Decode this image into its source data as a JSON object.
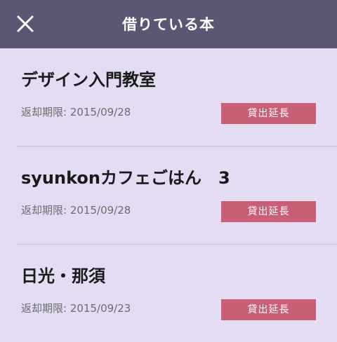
{
  "header": {
    "title": "借りている本",
    "close_icon": "close-icon"
  },
  "colors": {
    "header_bg": "#5d5574",
    "page_bg": "#e3dcf2",
    "button_bg": "#c85f75"
  },
  "books": [
    {
      "title": "デザイン入門教室",
      "due_label": "返却期限:",
      "due_date": "2015/09/28",
      "extend_label": "貸出延長"
    },
    {
      "title": "syunkonカフェごはん　3",
      "due_label": "返却期限:",
      "due_date": "2015/09/28",
      "extend_label": "貸出延長"
    },
    {
      "title": "日光・那須",
      "due_label": "返却期限:",
      "due_date": "2015/09/23",
      "extend_label": "貸出延長"
    }
  ]
}
